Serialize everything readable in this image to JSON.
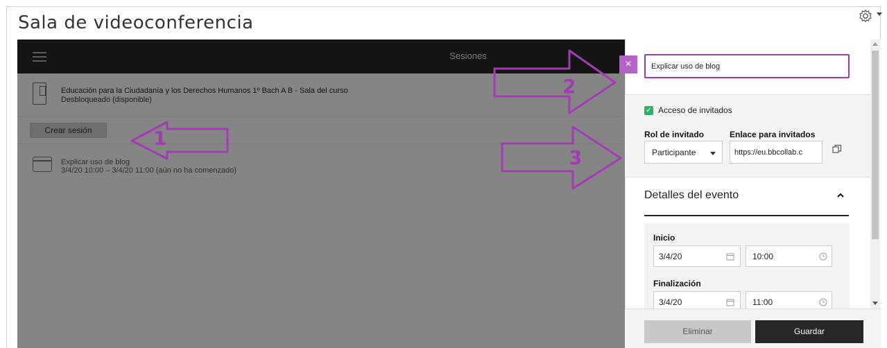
{
  "header": {
    "title": "Sala de videoconferencia"
  },
  "collab": {
    "top_title": "Sesiones",
    "course": {
      "name": "Educación para la Ciudadanía y los Derechos Humanos 1º Bach A B - Sala del curso",
      "status": "Desbloqueado (disponible)"
    },
    "create_session_label": "Crear sesión",
    "session": {
      "name": "Explicar uso de blog",
      "time": "3/4/20 10:00 – 3/4/20 11:00 (aún no ha comenzado)"
    }
  },
  "editor": {
    "close_glyph": "×",
    "title_value": "Explicar uso de blog",
    "guest_access_label": "Acceso de invitados",
    "guest_access_checked": true,
    "guest_role_label": "Rol de invitado",
    "guest_role_value": "Participante",
    "guest_link_label": "Enlace para invitados",
    "guest_link_value": "https://eu.bbcollab.c",
    "event_details_title": "Detalles del evento",
    "start_label": "Inicio",
    "start_date": "3/4/20",
    "start_time": "10:00",
    "end_label": "Finalización",
    "end_date": "3/4/20",
    "end_time": "11:00",
    "delete_label": "Eliminar",
    "save_label": "Guardar"
  },
  "annotations": {
    "arrow1": "1",
    "arrow2": "2",
    "arrow3": "3",
    "color": "#a23cb4"
  },
  "colors": {
    "accent_purple": "#9c3ab0",
    "close_button": "#b464c8",
    "dark_bar": "#262626",
    "checkbox_green": "#2fb36b"
  }
}
